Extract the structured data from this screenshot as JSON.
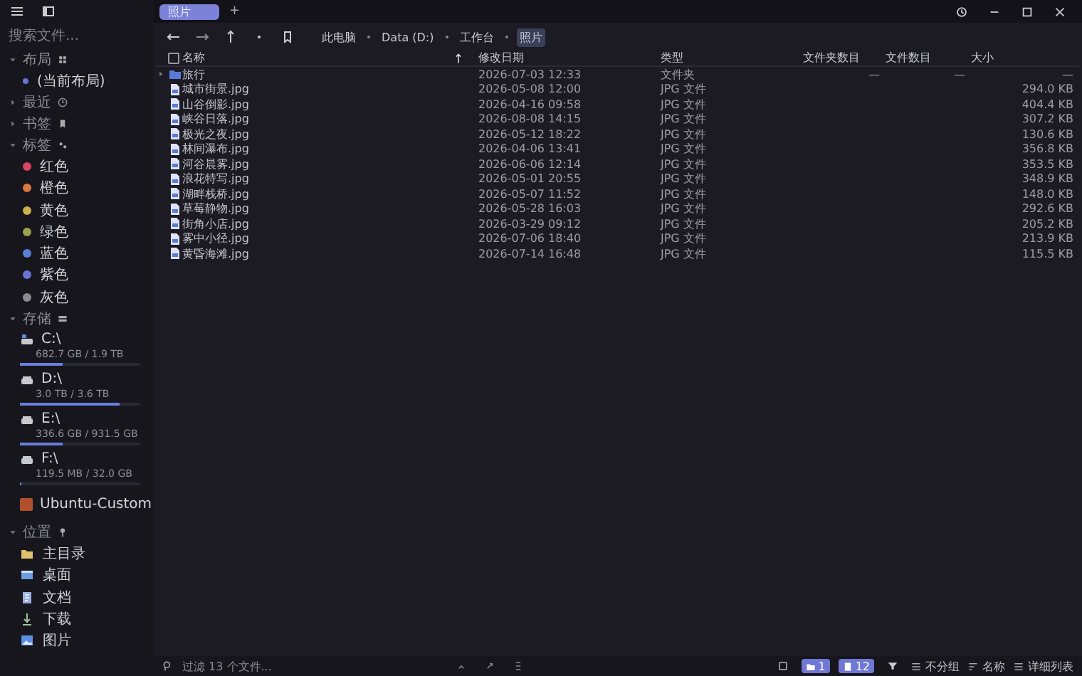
{
  "tabs": [
    {
      "label": "照片",
      "selected": true
    }
  ],
  "new_tab": "+",
  "sidebar": {
    "search": {
      "placeholder": "搜索文件..."
    },
    "sections": [
      {
        "kind": "layout",
        "title": "布局",
        "expanded": true,
        "items": [
          {
            "label": "(当前布局)"
          }
        ]
      },
      {
        "kind": "recent",
        "title": "最近",
        "expanded": false
      },
      {
        "kind": "bookmarks",
        "title": "书签",
        "expanded": false
      },
      {
        "kind": "tags",
        "title": "标签",
        "expanded": true,
        "items": [
          {
            "label": "红色",
            "color": "#d9455f"
          },
          {
            "label": "橙色",
            "color": "#d9773f"
          },
          {
            "label": "黄色",
            "color": "#c9b04a"
          },
          {
            "label": "绿色",
            "color": "#9aa24c"
          },
          {
            "label": "蓝色",
            "color": "#5b7fd9"
          },
          {
            "label": "紫色",
            "color": "#6a73d6"
          },
          {
            "label": "灰色",
            "color": "#8a8a8f"
          }
        ]
      },
      {
        "kind": "storage",
        "title": "存储",
        "expanded": true,
        "drives": [
          {
            "name": "C:\\",
            "usage": "682.7 GB / 1.9 TB",
            "level": 0.36,
            "system": true
          },
          {
            "name": "D:\\",
            "usage": "3.0 TB / 3.6 TB",
            "level": 0.83,
            "system": false
          },
          {
            "name": "E:\\",
            "usage": "336.6 GB / 931.5 GB",
            "level": 0.36,
            "system": false
          },
          {
            "name": "F:\\",
            "usage": "119.5 MB / 32.0 GB",
            "level": 0.004,
            "system": false
          }
        ],
        "wsl": "Ubuntu-Custom"
      },
      {
        "kind": "places",
        "title": "位置",
        "expanded": true,
        "items": [
          {
            "label": "主目录",
            "kind": "home"
          },
          {
            "label": "桌面",
            "kind": "desktop"
          },
          {
            "label": "文档",
            "kind": "documents"
          },
          {
            "label": "下载",
            "kind": "downloads"
          },
          {
            "label": "图片",
            "kind": "pictures"
          }
        ]
      }
    ]
  },
  "breadcrumb": [
    {
      "label": "此电脑",
      "selected": false
    },
    {
      "label": "Data (D:)",
      "selected": false
    },
    {
      "label": "工作台",
      "selected": false
    },
    {
      "label": "照片",
      "selected": true
    }
  ],
  "table": {
    "select_all": {
      "checked": false
    },
    "columns": [
      {
        "label": "名称",
        "sorted": true
      },
      {
        "label": "修改日期",
        "sorted": false
      },
      {
        "label": "类型",
        "sorted": false
      },
      {
        "label": "文件夹数目",
        "sorted": false
      },
      {
        "label": "文件数目",
        "sorted": false
      },
      {
        "label": "大小",
        "sorted": false
      }
    ],
    "rows": [
      {
        "kind": "folder",
        "expanded": false,
        "name": "旅行",
        "modified": "2026-07-03 12:33",
        "type": "文件夹",
        "folder_count": "—",
        "file_count": "—",
        "size": "—"
      },
      {
        "kind": "file",
        "name": "城市街景.jpg",
        "modified": "2026-05-08 12:00",
        "type": "JPG 文件",
        "size": "294.0 KB"
      },
      {
        "kind": "file",
        "name": "山谷倒影.jpg",
        "modified": "2026-04-16 09:58",
        "type": "JPG 文件",
        "size": "404.4 KB"
      },
      {
        "kind": "file",
        "name": "峡谷日落.jpg",
        "modified": "2026-08-08 14:15",
        "type": "JPG 文件",
        "size": "307.2 KB"
      },
      {
        "kind": "file",
        "name": "极光之夜.jpg",
        "modified": "2026-05-12 18:22",
        "type": "JPG 文件",
        "size": "130.6 KB"
      },
      {
        "kind": "file",
        "name": "林间瀑布.jpg",
        "modified": "2026-04-06 13:41",
        "type": "JPG 文件",
        "size": "356.8 KB"
      },
      {
        "kind": "file",
        "name": "河谷晨雾.jpg",
        "modified": "2026-06-06 12:14",
        "type": "JPG 文件",
        "size": "353.5 KB"
      },
      {
        "kind": "file",
        "name": "浪花特写.jpg",
        "modified": "2026-05-01 20:55",
        "type": "JPG 文件",
        "size": "348.9 KB"
      },
      {
        "kind": "file",
        "name": "湖畔栈桥.jpg",
        "modified": "2026-05-07 11:52",
        "type": "JPG 文件",
        "size": "148.0 KB"
      },
      {
        "kind": "file",
        "name": "草莓静物.jpg",
        "modified": "2026-05-28 16:03",
        "type": "JPG 文件",
        "size": "292.6 KB"
      },
      {
        "kind": "file",
        "name": "街角小店.jpg",
        "modified": "2026-03-29 09:12",
        "type": "JPG 文件",
        "size": "205.2 KB"
      },
      {
        "kind": "file",
        "name": "雾中小径.jpg",
        "modified": "2026-07-06 18:40",
        "type": "JPG 文件",
        "size": "213.9 KB"
      },
      {
        "kind": "file",
        "name": "黄昏海滩.jpg",
        "modified": "2026-07-14 16:48",
        "type": "JPG 文件",
        "size": "115.5 KB"
      }
    ]
  },
  "status_bar": {
    "filter": {
      "placeholder": "过滤 13 个文件..."
    },
    "folder_count": "1",
    "file_count": "12",
    "grouping": "不分组",
    "sort": "名称",
    "view": "详细列表"
  }
}
